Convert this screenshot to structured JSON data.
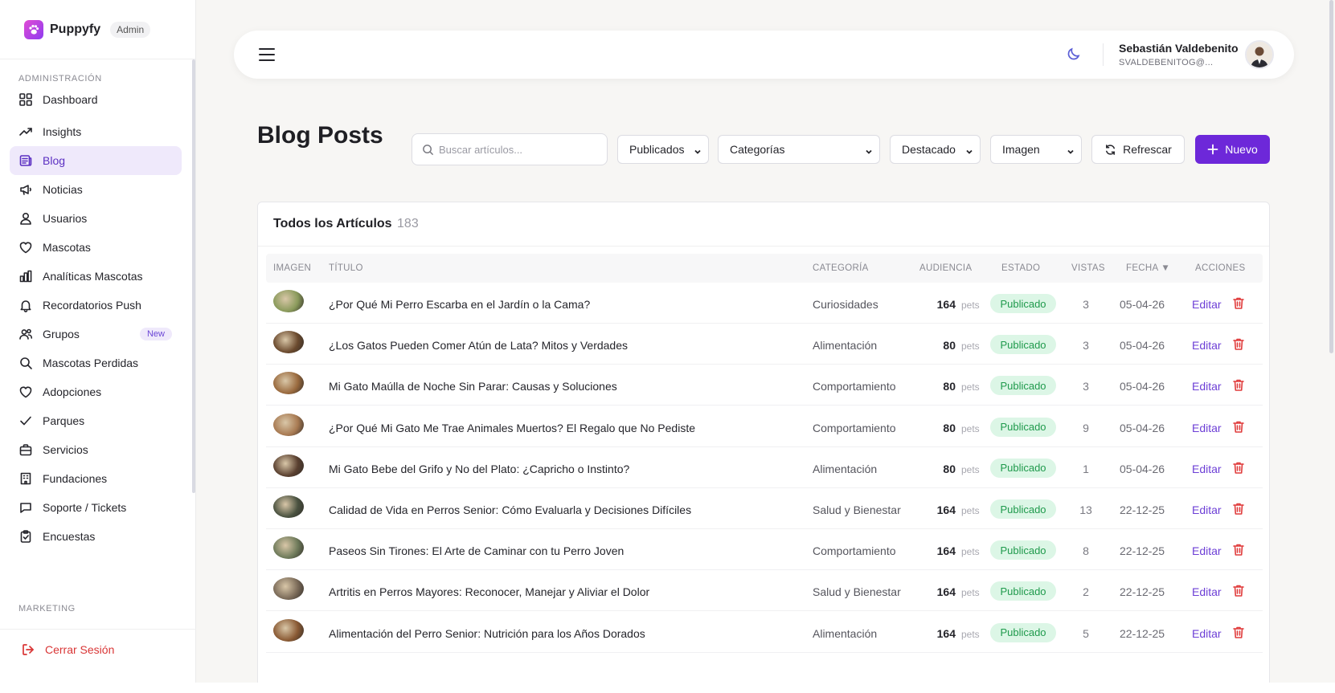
{
  "brand": {
    "name": "Puppyfy",
    "badge": "Admin"
  },
  "sidebar": {
    "section_admin": "ADMINISTRACIÓN",
    "section_marketing": "MARKETING",
    "items": [
      {
        "label": "Dashboard",
        "icon": "grid-icon"
      },
      {
        "label": "Insights",
        "icon": "trend-icon"
      },
      {
        "label": "Blog",
        "icon": "newspaper-icon",
        "active": true
      },
      {
        "label": "Noticias",
        "icon": "megaphone-icon"
      },
      {
        "label": "Usuarios",
        "icon": "user-icon"
      },
      {
        "label": "Mascotas",
        "icon": "heart-icon"
      },
      {
        "label": "Analíticas Mascotas",
        "icon": "bar-chart-icon"
      },
      {
        "label": "Recordatorios Push",
        "icon": "bell-icon"
      },
      {
        "label": "Grupos",
        "icon": "users-icon",
        "badge": "New"
      },
      {
        "label": "Mascotas Perdidas",
        "icon": "search-icon"
      },
      {
        "label": "Adopciones",
        "icon": "heart-icon"
      },
      {
        "label": "Parques",
        "icon": "check-icon"
      },
      {
        "label": "Servicios",
        "icon": "briefcase-icon"
      },
      {
        "label": "Fundaciones",
        "icon": "building-icon"
      },
      {
        "label": "Soporte / Tickets",
        "icon": "chat-icon"
      },
      {
        "label": "Encuestas",
        "icon": "clipboard-icon"
      }
    ],
    "logout": "Cerrar Sesión"
  },
  "header": {
    "user_name": "Sebastián Valdebenito",
    "user_email": "SVALDEBENITOG@..."
  },
  "page": {
    "title": "Blog Posts",
    "search_placeholder": "Buscar artículos...",
    "filters": {
      "status": "Publicados",
      "category": "Categorías",
      "featured": "Destacado",
      "image": "Imagen"
    },
    "refresh_label": "Refrescar",
    "new_label": "Nuevo"
  },
  "table": {
    "title": "Todos los Artículos",
    "count": "183",
    "columns": {
      "image": "IMAGEN",
      "title": "TÍTULO",
      "category": "CATEGORÍA",
      "audience": "AUDIENCIA",
      "status": "ESTADO",
      "views": "VISTAS",
      "date": "FECHA ▼",
      "actions": "ACCIONES"
    },
    "audience_unit": "pets",
    "edit_label": "Editar",
    "rows": [
      {
        "title": "¿Por Qué Mi Perro Escarba en el Jardín o la Cama?",
        "category": "Curiosidades",
        "audience": "164",
        "status": "Publicado",
        "views": "3",
        "date": "05-04-26",
        "thumb": "#8a9a5b"
      },
      {
        "title": "¿Los Gatos Pueden Comer Atún de Lata? Mitos y Verdades",
        "category": "Alimentación",
        "audience": "80",
        "status": "Publicado",
        "views": "3",
        "date": "05-04-26",
        "thumb": "#6b4a2e"
      },
      {
        "title": "Mi Gato Maúlla de Noche Sin Parar: Causas y Soluciones",
        "category": "Comportamiento",
        "audience": "80",
        "status": "Publicado",
        "views": "3",
        "date": "05-04-26",
        "thumb": "#9a6a3e"
      },
      {
        "title": "¿Por Qué Mi Gato Me Trae Animales Muertos? El Regalo que No Pediste",
        "category": "Comportamiento",
        "audience": "80",
        "status": "Publicado",
        "views": "9",
        "date": "05-04-26",
        "thumb": "#a87a52"
      },
      {
        "title": "Mi Gato Bebe del Grifo y No del Plato: ¿Capricho o Instinto?",
        "category": "Alimentación",
        "audience": "80",
        "status": "Publicado",
        "views": "1",
        "date": "05-04-26",
        "thumb": "#5a4030"
      },
      {
        "title": "Calidad de Vida en Perros Senior: Cómo Evaluarla y Decisiones Difíciles",
        "category": "Salud y Bienestar",
        "audience": "164",
        "status": "Publicado",
        "views": "13",
        "date": "22-12-25",
        "thumb": "#4a5240"
      },
      {
        "title": "Paseos Sin Tirones: El Arte de Caminar con tu Perro Joven",
        "category": "Comportamiento",
        "audience": "164",
        "status": "Publicado",
        "views": "8",
        "date": "22-12-25",
        "thumb": "#6e7a5a"
      },
      {
        "title": "Artritis en Perros Mayores: Reconocer, Manejar y Aliviar el Dolor",
        "category": "Salud y Bienestar",
        "audience": "164",
        "status": "Publicado",
        "views": "2",
        "date": "22-12-25",
        "thumb": "#7a6a58"
      },
      {
        "title": "Alimentación del Perro Senior: Nutrición para los Años Dorados",
        "category": "Alimentación",
        "audience": "164",
        "status": "Publicado",
        "views": "5",
        "date": "22-12-25",
        "thumb": "#8a5a34"
      }
    ]
  },
  "colors": {
    "accent": "#6d28d9",
    "active_bg": "#efe9fb",
    "status_bg": "#dcf6e6",
    "status_text": "#1f9a4c",
    "danger": "#d93636"
  }
}
